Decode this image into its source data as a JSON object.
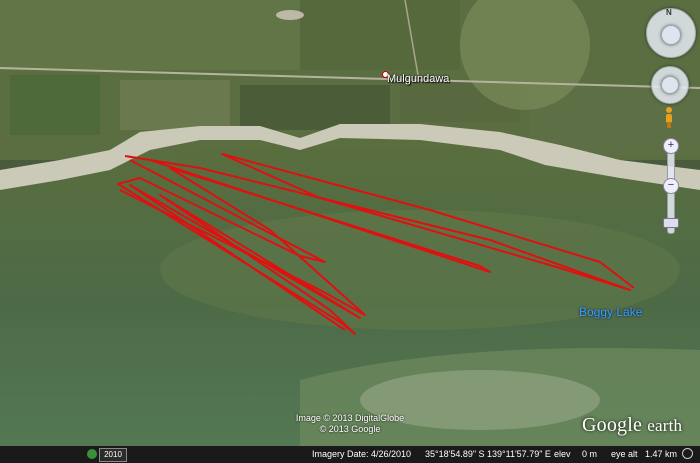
{
  "map": {
    "place_label": "Mulgundawa",
    "lake_label": "Boggy Lake",
    "copyright_line1": "Image © 2013 DigitalGlobe",
    "copyright_line2": "© 2013 Google",
    "logo_google": "Google",
    "logo_earth": "earth"
  },
  "status": {
    "year": "2010",
    "imagery_date": "Imagery Date: 4/26/2010",
    "lat": "35°18'54.89\" S",
    "lon": "139°11'57.79\" E",
    "elev_label": "elev",
    "elev_value": "0 m",
    "eye_alt_label": "eye alt",
    "eye_alt_value": "1.47 km"
  },
  "controls": {
    "compass_n": "N",
    "zoom_in": "+",
    "zoom_out": "−"
  },
  "colors": {
    "track": "#e01010",
    "water": "#4f6a45",
    "shore": "#c9c7b4"
  }
}
